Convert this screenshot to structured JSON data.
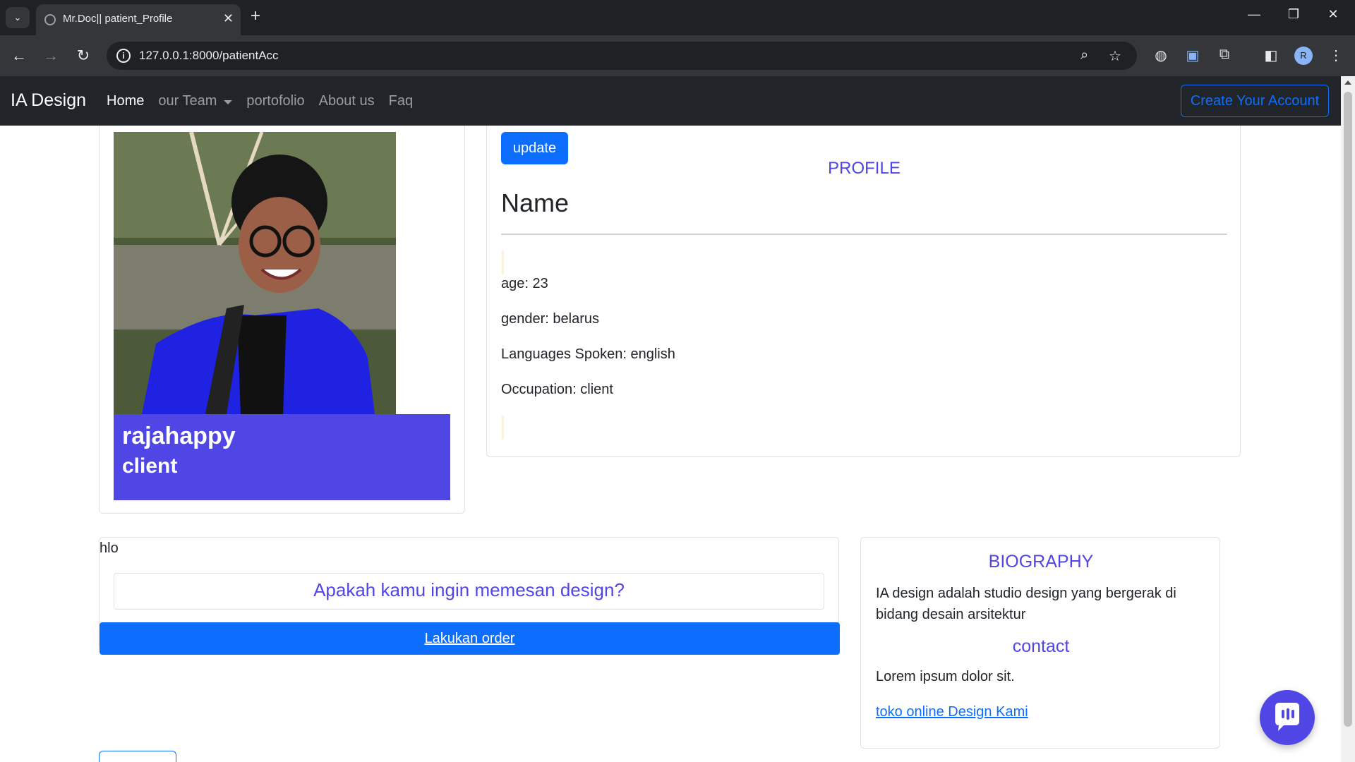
{
  "browser": {
    "tab_title": "Mr.Doc|| patient_Profile",
    "url": "127.0.0.1:8000/patientAcc",
    "profile_initial": "R"
  },
  "navbar": {
    "brand": "IA Design",
    "links": [
      "Home",
      "our Team",
      "portofolio",
      "About us",
      "Faq"
    ],
    "cta": "Create Your Account"
  },
  "profile_card": {
    "username": "rajahappy",
    "role": "client"
  },
  "profile": {
    "update_label": "update",
    "title": "PROFILE",
    "name_heading": "Name",
    "age": "age: 23",
    "gender": "gender: belarus",
    "languages": "Languages Spoken: english",
    "occupation": "Occupation: client"
  },
  "order": {
    "note": "hlo",
    "question": "Apakah kamu ingin memesan design?",
    "button": "Lakukan order"
  },
  "bio": {
    "title": "BIOGRAPHY",
    "text": "IA design adalah studio design yang bergerak di bidang desain arsitektur",
    "contact_title": "contact",
    "contact_text": "Lorem ipsum dolor sit.",
    "link": "toko online Design Kami"
  },
  "colors": {
    "accent": "#4f46e5",
    "primary": "#0d6efd",
    "navbar": "#212529"
  }
}
